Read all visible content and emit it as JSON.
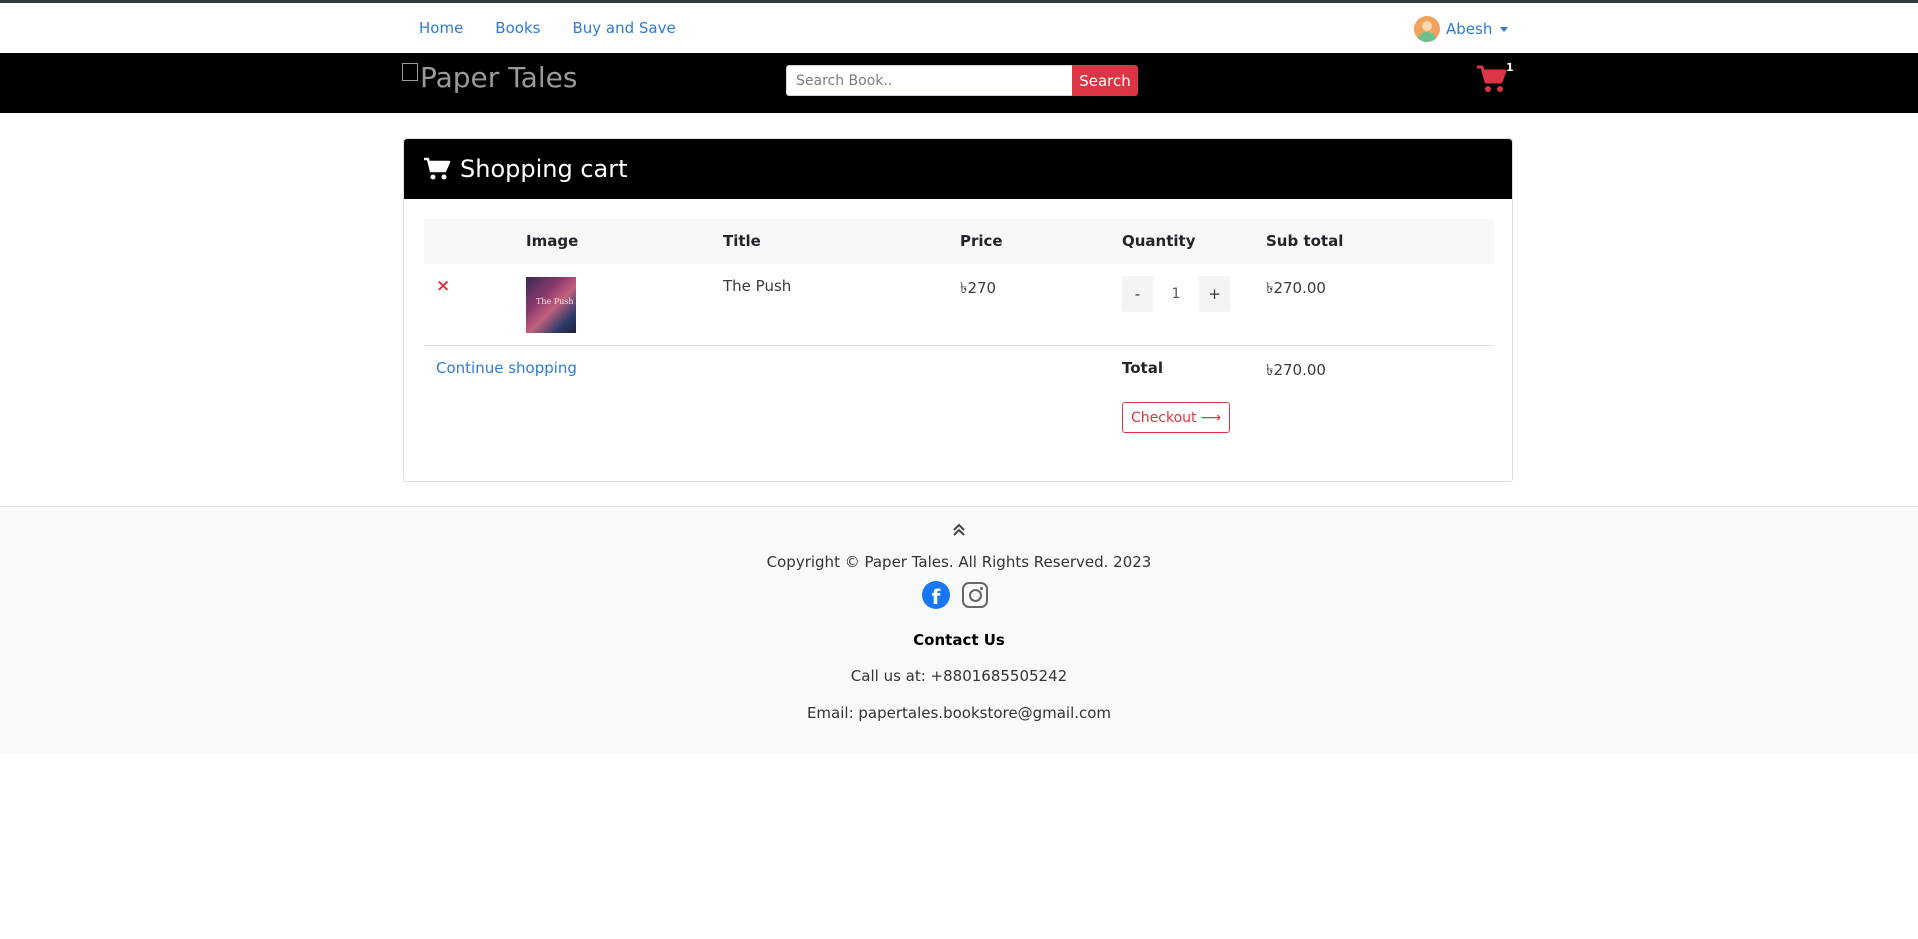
{
  "nav": {
    "links": [
      "Home",
      "Books",
      "Buy and Save"
    ],
    "user_name": "Abesh"
  },
  "header": {
    "logo_alt": "Paper Tales",
    "search_placeholder": "Search Book..",
    "search_button": "Search",
    "cart_count": "1"
  },
  "cart": {
    "title": "Shopping cart",
    "columns": [
      "Image",
      "Title",
      "Price",
      "Quantity",
      "Sub total"
    ],
    "items": [
      {
        "remove": "×",
        "image_text": "The Push",
        "title": "The Push",
        "price": "৳270",
        "qty_minus": "-",
        "quantity": "1",
        "qty_plus": "+",
        "subtotal": "৳270.00"
      }
    ],
    "continue_label": "Continue shopping",
    "total_label": "Total",
    "total_value": "৳270.00",
    "checkout_label": "Checkout ⟶"
  },
  "footer": {
    "up_icon": "⌃",
    "copyright": "Copyright © Paper Tales. All Rights Reserved. 2023",
    "contact_title": "Contact Us",
    "phone": "Call us at: +8801685505242",
    "email": "Email: papertales.bookstore@gmail.com"
  },
  "colors": {
    "accent": "#dc3545",
    "link": "#2f7ad6",
    "header_bg": "#000000",
    "footer_bg": "#f8f9fa"
  }
}
